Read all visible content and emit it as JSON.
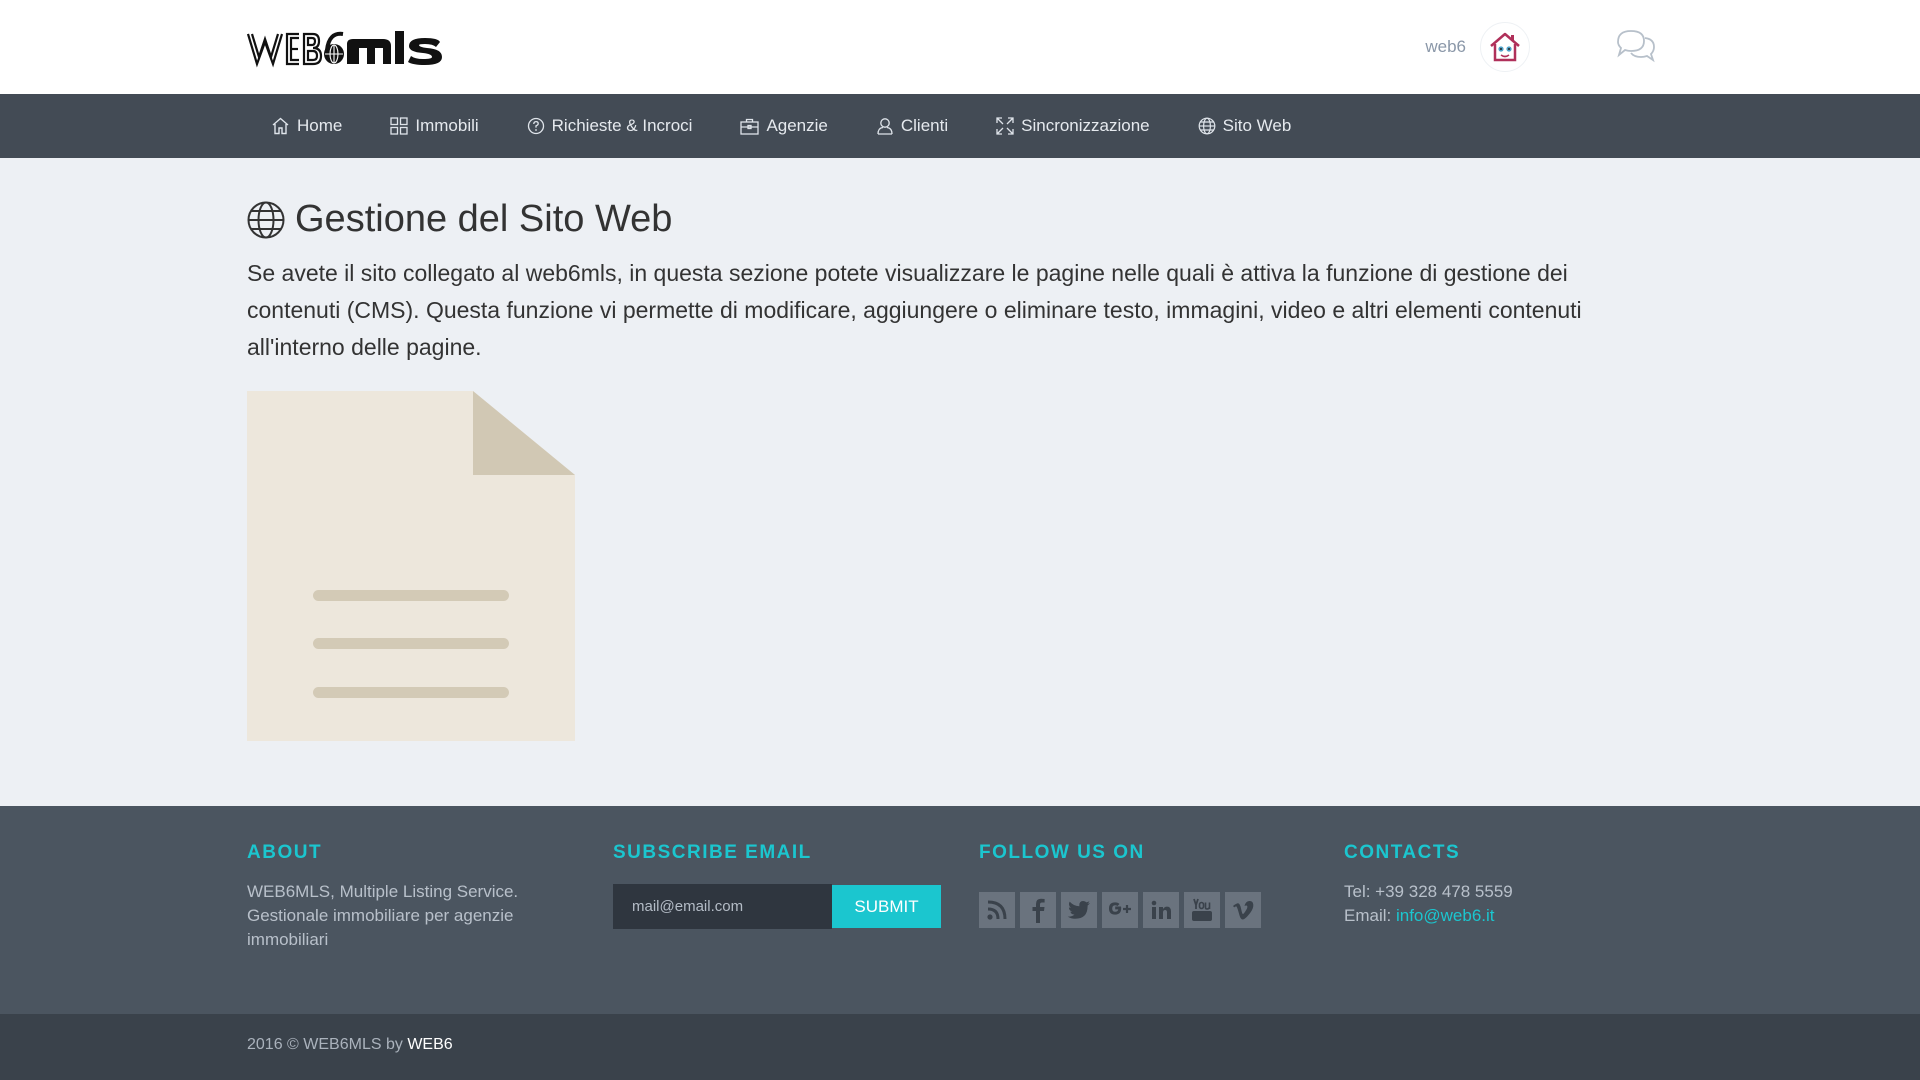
{
  "header": {
    "logo_text": "WEB6mls",
    "user_name": "web6"
  },
  "nav": {
    "items": [
      {
        "label": "Home",
        "icon": "home-icon"
      },
      {
        "label": "Immobili",
        "icon": "grid-icon"
      },
      {
        "label": "Richieste & Incroci",
        "icon": "question-circle-icon"
      },
      {
        "label": "Agenzie",
        "icon": "briefcase-icon"
      },
      {
        "label": "Clienti",
        "icon": "user-icon"
      },
      {
        "label": "Sincronizzazione",
        "icon": "expand-arrows-icon"
      },
      {
        "label": "Sito Web",
        "icon": "globe-icon"
      }
    ]
  },
  "main": {
    "title": "Gestione del Sito Web",
    "title_icon": "globe-icon",
    "description": "Se avete il sito collegato al web6mls, in questa sezione potete visualizzare le pagine nelle quali è attiva la funzione di gestione dei contenuti (CMS). Questa funzione vi permette di modificare, aggiungere o eliminare testo, immagini, video e altri elementi contenuti all'interno delle pagine.",
    "placeholder_icon": "document-icon"
  },
  "footer": {
    "about": {
      "heading": "ABOUT",
      "text": "WEB6MLS, Multiple Listing Service. Gestionale immobiliare per agenzie immobiliari"
    },
    "subscribe": {
      "heading": "SUBSCRIBE EMAIL",
      "placeholder": "mail@email.com",
      "button": "SUBMIT"
    },
    "follow": {
      "heading": "FOLLOW US ON",
      "icons": [
        "rss-icon",
        "facebook-icon",
        "twitter-icon",
        "google-plus-icon",
        "linkedin-icon",
        "youtube-icon",
        "vimeo-icon"
      ]
    },
    "contacts": {
      "heading": "CONTACTS",
      "tel": "Tel: +39 328 478 5559",
      "email_label": "Email: ",
      "email": "info@web6.it"
    }
  },
  "bottom": {
    "copyright": "2016 © WEB6MLS by ",
    "brand": "WEB6"
  },
  "colors": {
    "accent": "#1bc6cf",
    "nav_bg": "#434b55",
    "footer_bg": "#4b5560",
    "bottom_bg": "#3a424b",
    "page_bg": "#edf0f4"
  }
}
